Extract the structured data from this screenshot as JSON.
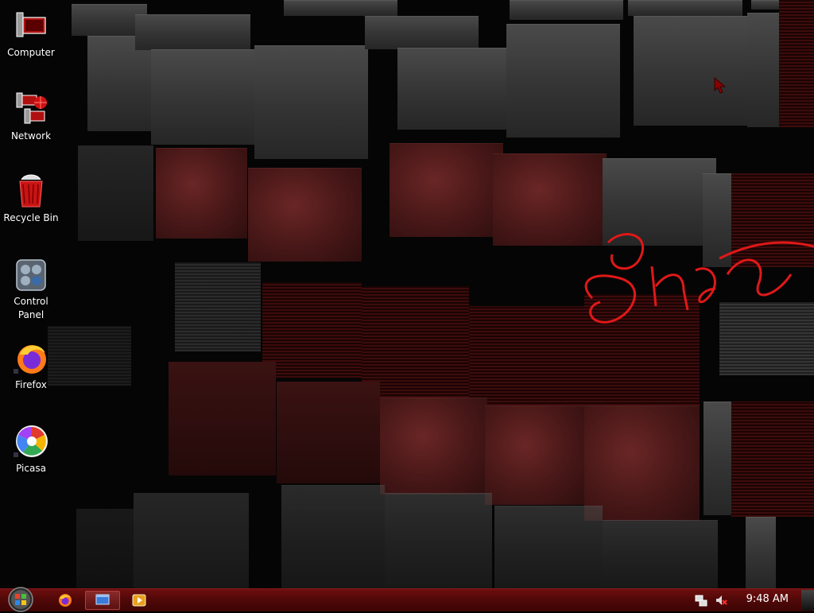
{
  "desktop_icons": [
    {
      "label": "Computer",
      "icon": "computer-icon"
    },
    {
      "label": "Network",
      "icon": "network-icon"
    },
    {
      "label": "Recycle Bin",
      "icon": "recycle-bin-icon"
    },
    {
      "label": "Control\nPanel",
      "icon": "control-panel-icon"
    },
    {
      "label": "Firefox",
      "icon": "firefox-icon"
    },
    {
      "label": "Picasa",
      "icon": "picasa-icon"
    }
  ],
  "taskbar": {
    "start_icon": "windows-start-orb-icon",
    "quick_launch": [
      "firefox-icon",
      "show-desktop-icon",
      "media-player-icon"
    ],
    "tray_icons": [
      "network-status-icon",
      "volume-muted-icon"
    ],
    "clock": "9:48 AM"
  },
  "colors": {
    "taskbar": "#5a0a0a",
    "accent_red": "#cc1111"
  }
}
